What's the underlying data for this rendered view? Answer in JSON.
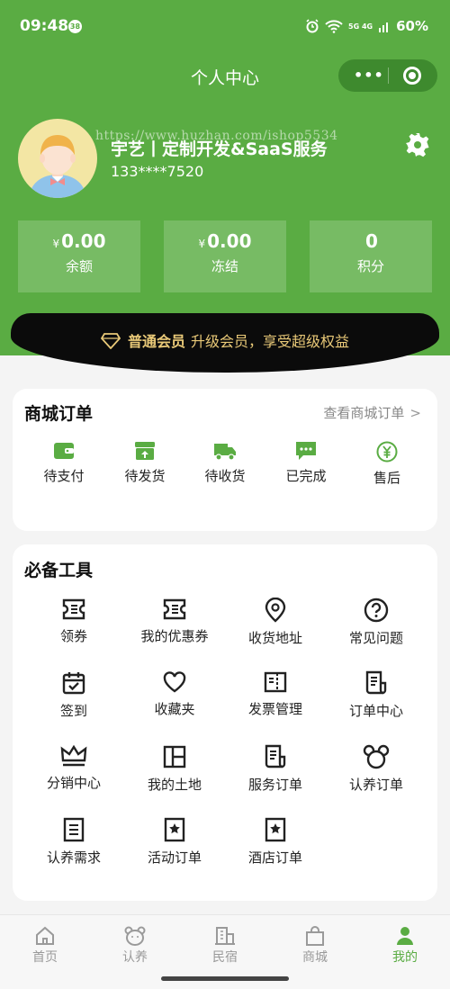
{
  "status_bar": {
    "time": "09:48",
    "badge": "38",
    "network": "5G 4G",
    "battery": "60%"
  },
  "navbar": {
    "title": "个人中心"
  },
  "user": {
    "name": "宇艺丨定制开发&SaaS服务",
    "phone": "133****7520",
    "watermark": "https://www.huzhan.com/ishop5534"
  },
  "stats": [
    {
      "currency": "¥",
      "value": "0.00",
      "label": "余额"
    },
    {
      "currency": "¥",
      "value": "0.00",
      "label": "冻结"
    },
    {
      "currency": "",
      "value": "0",
      "label": "积分"
    }
  ],
  "vip": {
    "level": "普通会员",
    "text": "升级会员，享受超级权益"
  },
  "orders": {
    "title": "商城订单",
    "link": "查看商城订单",
    "items": [
      {
        "label": "待支付",
        "icon": "wallet-icon"
      },
      {
        "label": "待发货",
        "icon": "box-up-icon"
      },
      {
        "label": "待收货",
        "icon": "truck-icon"
      },
      {
        "label": "已完成",
        "icon": "chat-dots-icon"
      },
      {
        "label": "售后",
        "icon": "yen-circle-icon"
      }
    ]
  },
  "tools": {
    "title": "必备工具",
    "items": [
      {
        "label": "领券",
        "icon": "ticket-icon"
      },
      {
        "label": "我的优惠券",
        "icon": "ticket-icon"
      },
      {
        "label": "收货地址",
        "icon": "location-pin-icon"
      },
      {
        "label": "常见问题",
        "icon": "question-circle-icon"
      },
      {
        "label": "签到",
        "icon": "calendar-check-icon"
      },
      {
        "label": "收藏夹",
        "icon": "heart-icon"
      },
      {
        "label": "发票管理",
        "icon": "invoice-icon"
      },
      {
        "label": "订单中心",
        "icon": "document-icon"
      },
      {
        "label": "分销中心",
        "icon": "crown-icon"
      },
      {
        "label": "我的土地",
        "icon": "grid-icon"
      },
      {
        "label": "服务订单",
        "icon": "document-icon"
      },
      {
        "label": "认养订单",
        "icon": "bear-icon"
      },
      {
        "label": "认养需求",
        "icon": "list-doc-icon"
      },
      {
        "label": "活动订单",
        "icon": "star-bookmark-icon"
      },
      {
        "label": "酒店订单",
        "icon": "star-bookmark-icon"
      }
    ]
  },
  "tabbar": {
    "items": [
      {
        "label": "首页",
        "icon": "home-icon",
        "active": false
      },
      {
        "label": "认养",
        "icon": "bear-face-icon",
        "active": false
      },
      {
        "label": "民宿",
        "icon": "building-icon",
        "active": false
      },
      {
        "label": "商城",
        "icon": "shopping-bag-icon",
        "active": false
      },
      {
        "label": "我的",
        "icon": "person-icon",
        "active": true
      }
    ]
  },
  "colors": {
    "primary": "#5aac43",
    "vip_gold": "#e9c978",
    "vip_bg": "#0b0b0b",
    "page_bg": "#f4f4f4"
  }
}
